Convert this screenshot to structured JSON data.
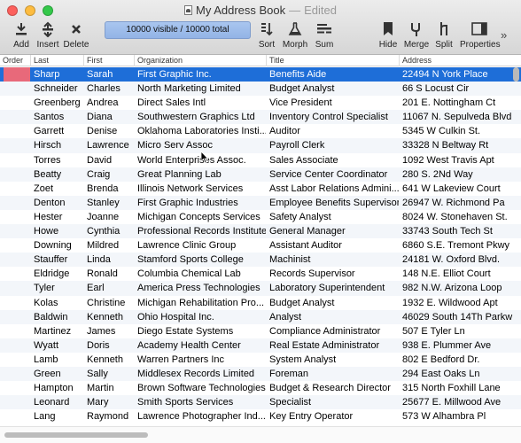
{
  "window": {
    "title": "My Address Book",
    "separator": "—",
    "status": "Edited"
  },
  "toolbar": {
    "status_text": "10000 visible / 10000 total",
    "buttons": [
      {
        "name": "add",
        "label": "Add",
        "icon": "add-icon"
      },
      {
        "name": "insert",
        "label": "Insert",
        "icon": "insert-icon"
      },
      {
        "name": "delete",
        "label": "Delete",
        "icon": "delete-icon"
      },
      {
        "name": "sort",
        "label": "Sort",
        "icon": "sort-icon"
      },
      {
        "name": "morph",
        "label": "Morph",
        "icon": "flask-icon"
      },
      {
        "name": "sum",
        "label": "Sum",
        "icon": "sum-icon"
      },
      {
        "name": "hide",
        "label": "Hide",
        "icon": "bookmark-icon"
      },
      {
        "name": "merge",
        "label": "Merge",
        "icon": "merge-icon"
      },
      {
        "name": "split",
        "label": "Split",
        "icon": "split-icon"
      },
      {
        "name": "properties",
        "label": "Properties",
        "icon": "properties-icon"
      }
    ],
    "more": "»"
  },
  "table": {
    "columns": [
      "Order",
      "Last",
      "First",
      "Organization",
      "Title",
      "Address"
    ],
    "selected_row": 0,
    "rows": [
      [
        "",
        "Sharp",
        "Sarah",
        "First Graphic Inc.",
        "Benefits Aide",
        "22494 N York Place"
      ],
      [
        "",
        "Schneider",
        "Charles",
        "North Marketing Limited",
        "Budget Analyst",
        "66 S Locust Cir"
      ],
      [
        "",
        "Greenberg",
        "Andrea",
        "Direct Sales Intl",
        "Vice President",
        "201 E. Nottingham Ct"
      ],
      [
        "",
        "Santos",
        "Diana",
        "Southwestern Graphics Ltd",
        "Inventory Control Specialist",
        "11067 N. Sepulveda Blvd"
      ],
      [
        "",
        "Garrett",
        "Denise",
        "Oklahoma Laboratories Insti...",
        "Auditor",
        "5345 W Culkin St."
      ],
      [
        "",
        "Hirsch",
        "Lawrence",
        "Micro Serv Assoc",
        "Payroll Clerk",
        "33328 N Beltway Rt"
      ],
      [
        "",
        "Torres",
        "David",
        "World Enterprises Assoc.",
        "Sales Associate",
        "1092 West Travis Apt"
      ],
      [
        "",
        "Beatty",
        "Craig",
        "Great Planning Lab",
        "Service Center Coordinator",
        "280 S. 2Nd Way"
      ],
      [
        "",
        "Zoet",
        "Brenda",
        "Illinois Network Services",
        "Asst Labor Relations Admini...",
        "641 W Lakeview Court"
      ],
      [
        "",
        "Denton",
        "Stanley",
        "First Graphic Industries",
        "Employee Benefits Supervisor",
        "26947 W. Richmond Pa"
      ],
      [
        "",
        "Hester",
        "Joanne",
        "Michigan Concepts Services",
        "Safety Analyst",
        "8024 W. Stonehaven St."
      ],
      [
        "",
        "Howe",
        "Cynthia",
        "Professional Records Institute",
        "General Manager",
        "33743 South Tech St"
      ],
      [
        "",
        "Downing",
        "Mildred",
        "Lawrence Clinic Group",
        "Assistant Auditor",
        "6860 S.E. Tremont Pkwy"
      ],
      [
        "",
        "Stauffer",
        "Linda",
        "Stamford Sports College",
        "Machinist",
        "24181 W. Oxford Blvd."
      ],
      [
        "",
        "Eldridge",
        "Ronald",
        "Columbia Chemical Lab",
        "Records Supervisor",
        "148 N.E. Elliot Court"
      ],
      [
        "",
        "Tyler",
        "Earl",
        "America Press Technologies",
        "Laboratory Superintendent",
        "982 N.W. Arizona Loop"
      ],
      [
        "",
        "Kolas",
        "Christine",
        "Michigan Rehabilitation Pro...",
        "Budget Analyst",
        "1932 E. Wildwood Apt"
      ],
      [
        "",
        "Baldwin",
        "Kenneth",
        "Ohio Hospital Inc.",
        "Analyst",
        "46029 South 14Th Parkw"
      ],
      [
        "",
        "Martinez",
        "James",
        "Diego Estate Systems",
        "Compliance Administrator",
        "507 E Tyler Ln"
      ],
      [
        "",
        "Wyatt",
        "Doris",
        "Academy Health Center",
        "Real Estate Administrator",
        "938 E. Plummer Ave"
      ],
      [
        "",
        "Lamb",
        "Kenneth",
        "Warren Partners Inc",
        "System Analyst",
        "802 E Bedford Dr."
      ],
      [
        "",
        "Green",
        "Sally",
        "Middlesex Records Limited",
        "Foreman",
        "294 East Oaks Ln"
      ],
      [
        "",
        "Hampton",
        "Martin",
        "Brown Software Technologies",
        "Budget & Research Director",
        "315 North Foxhill Lane"
      ],
      [
        "",
        "Leonard",
        "Mary",
        "Smith Sports Services",
        "Specialist",
        "25677 E. Millwood Ave"
      ],
      [
        "",
        "Lang",
        "Raymond",
        "Lawrence Photographer Ind...",
        "Key Entry Operator",
        "573 W Alhambra Pl"
      ]
    ]
  }
}
